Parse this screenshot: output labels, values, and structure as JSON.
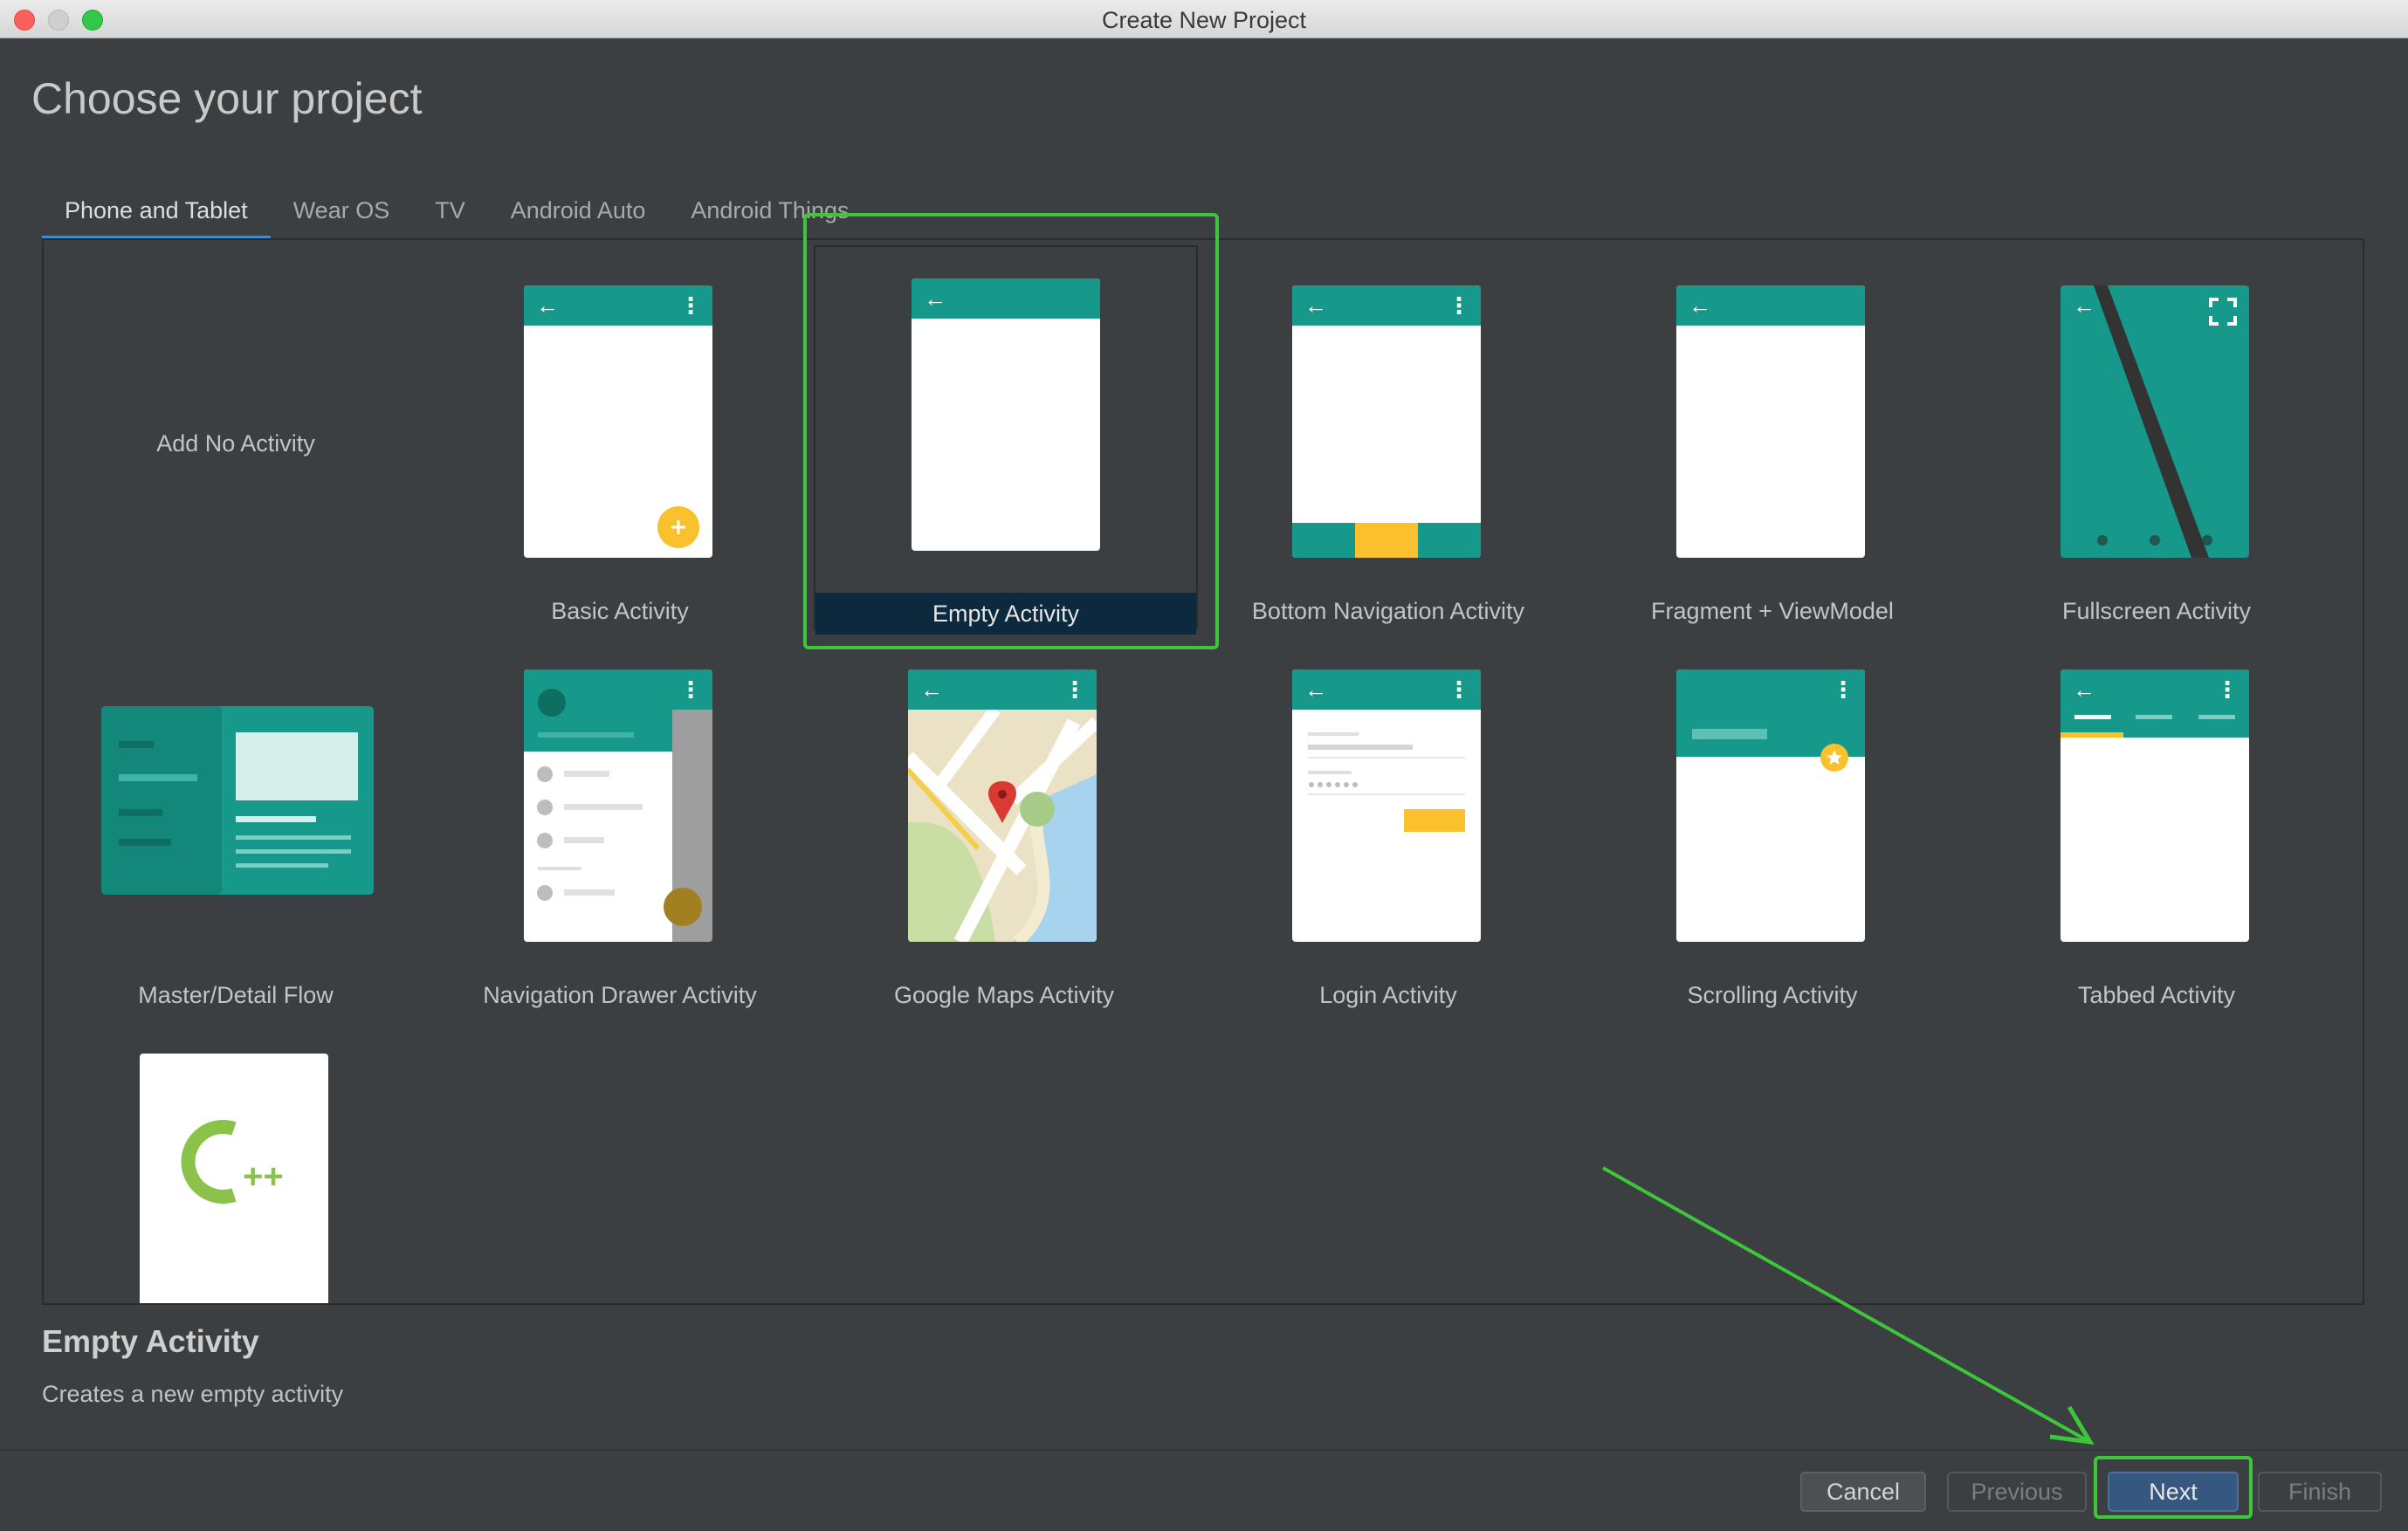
{
  "window": {
    "title": "Create New Project"
  },
  "page": {
    "title": "Choose your project"
  },
  "tabs": [
    {
      "label": "Phone and Tablet",
      "active": true
    },
    {
      "label": "Wear OS"
    },
    {
      "label": "TV"
    },
    {
      "label": "Android Auto"
    },
    {
      "label": "Android Things"
    }
  ],
  "templates": {
    "no_activity": "Add No Activity",
    "basic": "Basic Activity",
    "empty": "Empty Activity",
    "bottom_nav": "Bottom Navigation Activity",
    "fragment_vm": "Fragment + ViewModel",
    "fullscreen": "Fullscreen Activity",
    "master_detail": "Master/Detail Flow",
    "nav_drawer": "Navigation Drawer Activity",
    "maps": "Google Maps Activity",
    "login": "Login Activity",
    "scrolling": "Scrolling Activity",
    "tabbed": "Tabbed Activity",
    "cpp_logo": "C++"
  },
  "selected": {
    "title": "Empty Activity",
    "description": "Creates a new empty activity"
  },
  "buttons": {
    "cancel": "Cancel",
    "previous": "Previous",
    "next": "Next",
    "finish": "Finish"
  },
  "colors": {
    "accent_teal": "#16998a",
    "fab_yellow": "#fbc02d",
    "annotation_green": "#3ec63a",
    "tab_underline": "#4a88c7"
  },
  "icons": {
    "back": "arrow-back-icon",
    "overflow": "overflow-menu-icon",
    "fullscreen": "fullscreen-icon",
    "add": "plus-icon",
    "star": "star-icon",
    "map_pin": "map-pin-icon"
  }
}
